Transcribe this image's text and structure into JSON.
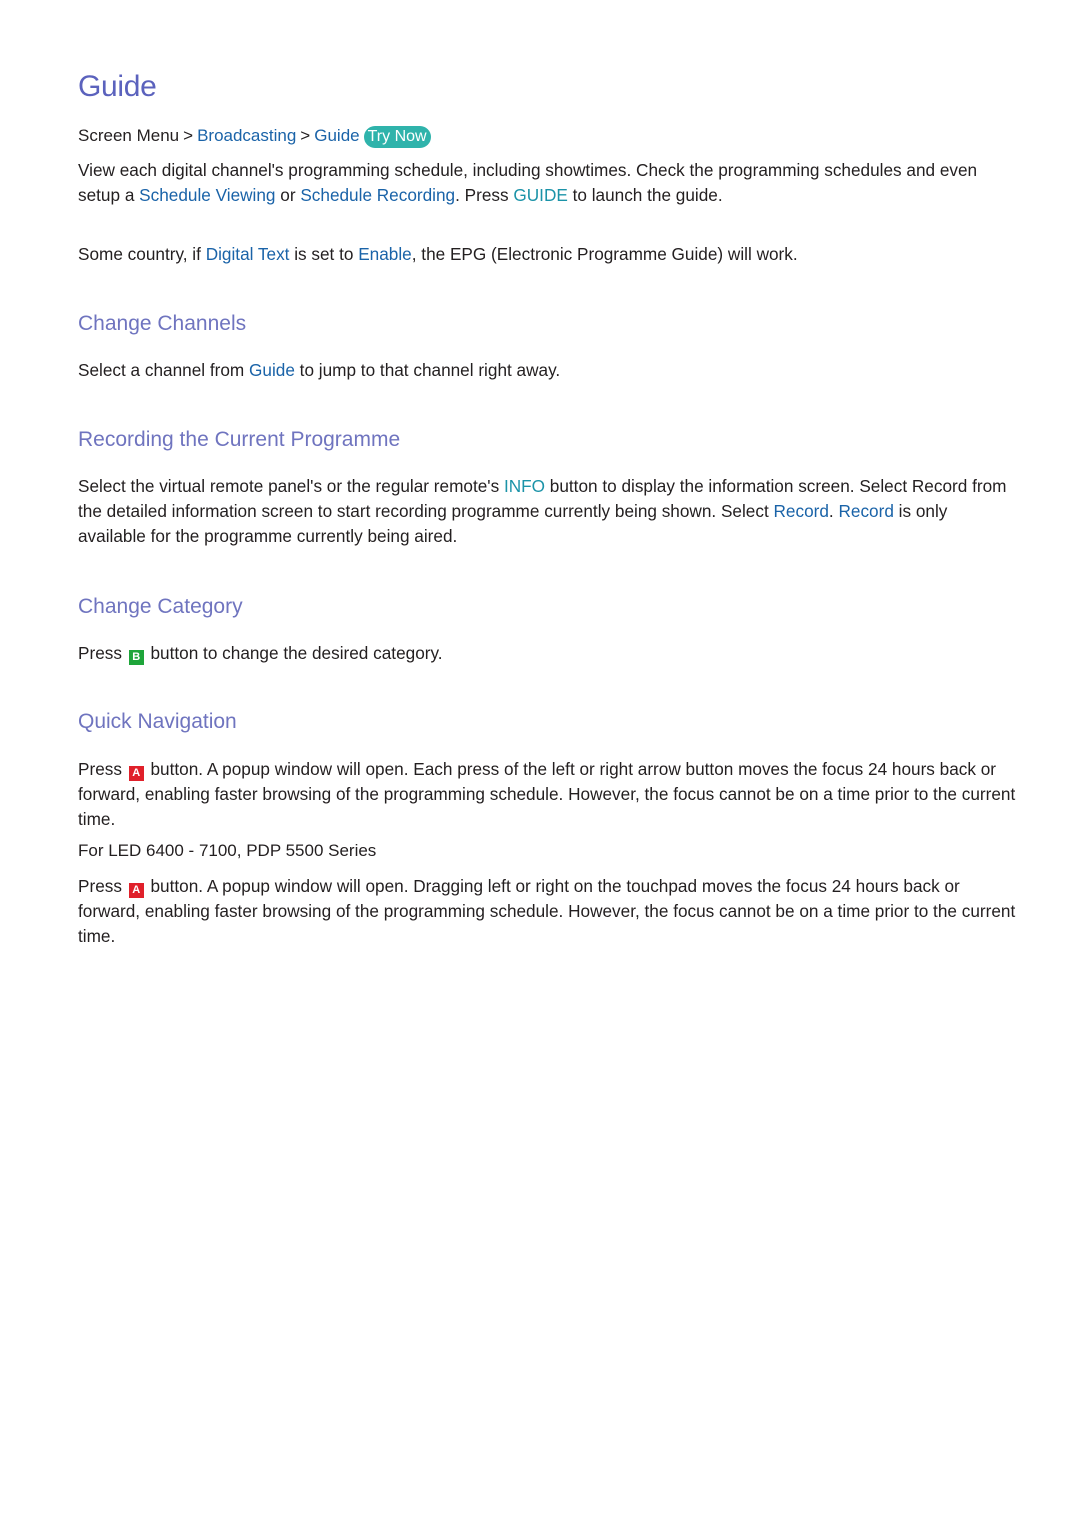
{
  "page": {
    "title": "Guide",
    "breadcrumb": {
      "items": [
        "Screen Menu",
        "Broadcasting",
        "Guide"
      ],
      "separator": ">",
      "try_now": "Try Now"
    },
    "intro": {
      "p1": {
        "t1": "View each digital channel's programming schedule, including showtimes. Check the programming schedules and even setup a ",
        "l1": "Schedule Viewing",
        "t2": " or ",
        "l2": "Schedule Recording",
        "t3": ". Press ",
        "l3": "GUIDE",
        "t4": " to launch the guide."
      },
      "p2": {
        "t1": "Some country, if ",
        "l1": "Digital Text",
        "t2": " is set to ",
        "l2": "Enable",
        "t3": ", the EPG (Electronic Programme Guide) will work."
      }
    },
    "sections": [
      {
        "heading": "Change Channels",
        "body": {
          "t1": "Select a channel from ",
          "l1": "Guide",
          "t2": " to jump to that channel right away."
        }
      },
      {
        "heading": "Recording the Current Programme",
        "body": {
          "t1": "Select the virtual remote panel's or the regular remote's ",
          "l1": "INFO",
          "t2": " button to display the information screen. Select Record from the detailed information screen to start recording programme currently being shown. Select ",
          "l2": "Record",
          "t3": ". ",
          "l3": "Record",
          "t4": " is only available for the programme currently being aired."
        }
      },
      {
        "heading": "Change Category",
        "body": {
          "t1": "Press ",
          "key": "B",
          "t2": " button to change the desired category."
        }
      },
      {
        "heading": "Quick Navigation",
        "body": {
          "t1": "Press ",
          "key": "A",
          "t2": " button. A popup window will open. Each press of the left or right arrow button moves the focus 24 hours back or forward, enabling faster browsing of the programming schedule. However, the focus cannot be on a time prior to the current time."
        },
        "sub_label": "For LED 6400 - 7100, PDP 5500 Series",
        "body2": {
          "t1": "Press ",
          "key": "A",
          "t2": " button. A popup window will open. Dragging left or right on the touchpad moves the focus 24 hours back or forward, enabling faster browsing of the programming schedule. However, the focus cannot be on a time prior to the current time."
        }
      }
    ],
    "colors": {
      "title": "#5b62bd",
      "heading": "#6f74bf",
      "link": "#1a63a8",
      "button_text": "#1b93a8",
      "try_now_bg": "#2fb3ab",
      "key_a": "#e0202a",
      "key_b": "#1ea53a"
    }
  }
}
